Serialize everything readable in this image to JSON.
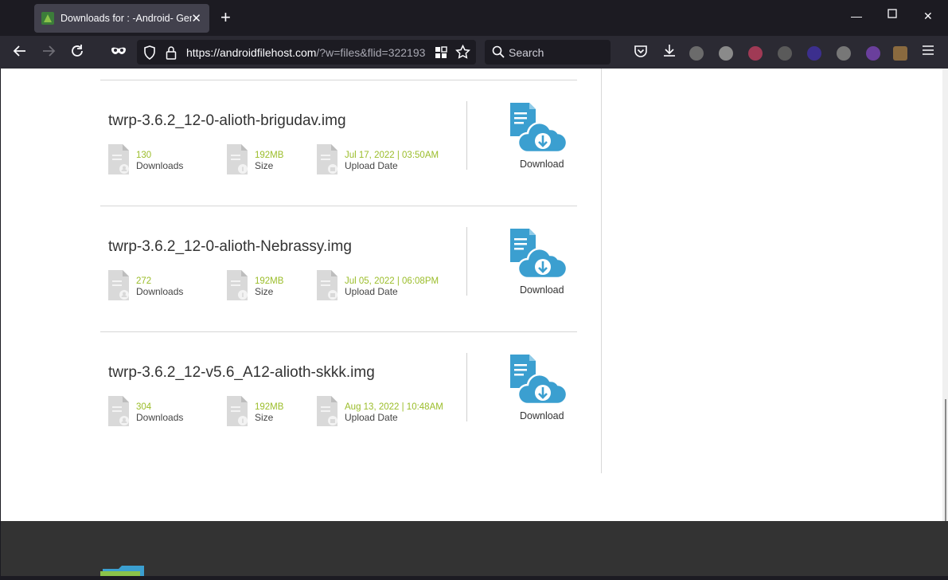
{
  "browser": {
    "tab_title": "Downloads for : -Android- Generic",
    "url_host": "https://androidfilehost.com",
    "url_path": "/?w=files&flid=322193",
    "search_placeholder": "Search"
  },
  "files": [
    {
      "name": "twrp-3.6.2_12-0-alioth-brigudav.img",
      "downloads": "130",
      "downloads_label": "Downloads",
      "size": "192MB",
      "size_label": "Size",
      "date": "Jul 17, 2022 | 03:50AM",
      "date_label": "Upload Date",
      "download_label": "Download"
    },
    {
      "name": "twrp-3.6.2_12-0-alioth-Nebrassy.img",
      "downloads": "272",
      "downloads_label": "Downloads",
      "size": "192MB",
      "size_label": "Size",
      "date": "Jul 05, 2022 | 06:08PM",
      "date_label": "Upload Date",
      "download_label": "Download"
    },
    {
      "name": "twrp-3.6.2_12-v5.6_A12-alioth-skkk.img",
      "downloads": "304",
      "downloads_label": "Downloads",
      "size": "192MB",
      "size_label": "Size",
      "date": "Aug 13, 2022 | 10:48AM",
      "date_label": "Upload Date",
      "download_label": "Download"
    }
  ],
  "colors": {
    "accent": "#9bbd2a",
    "icon_blue": "#3b9fd0"
  }
}
